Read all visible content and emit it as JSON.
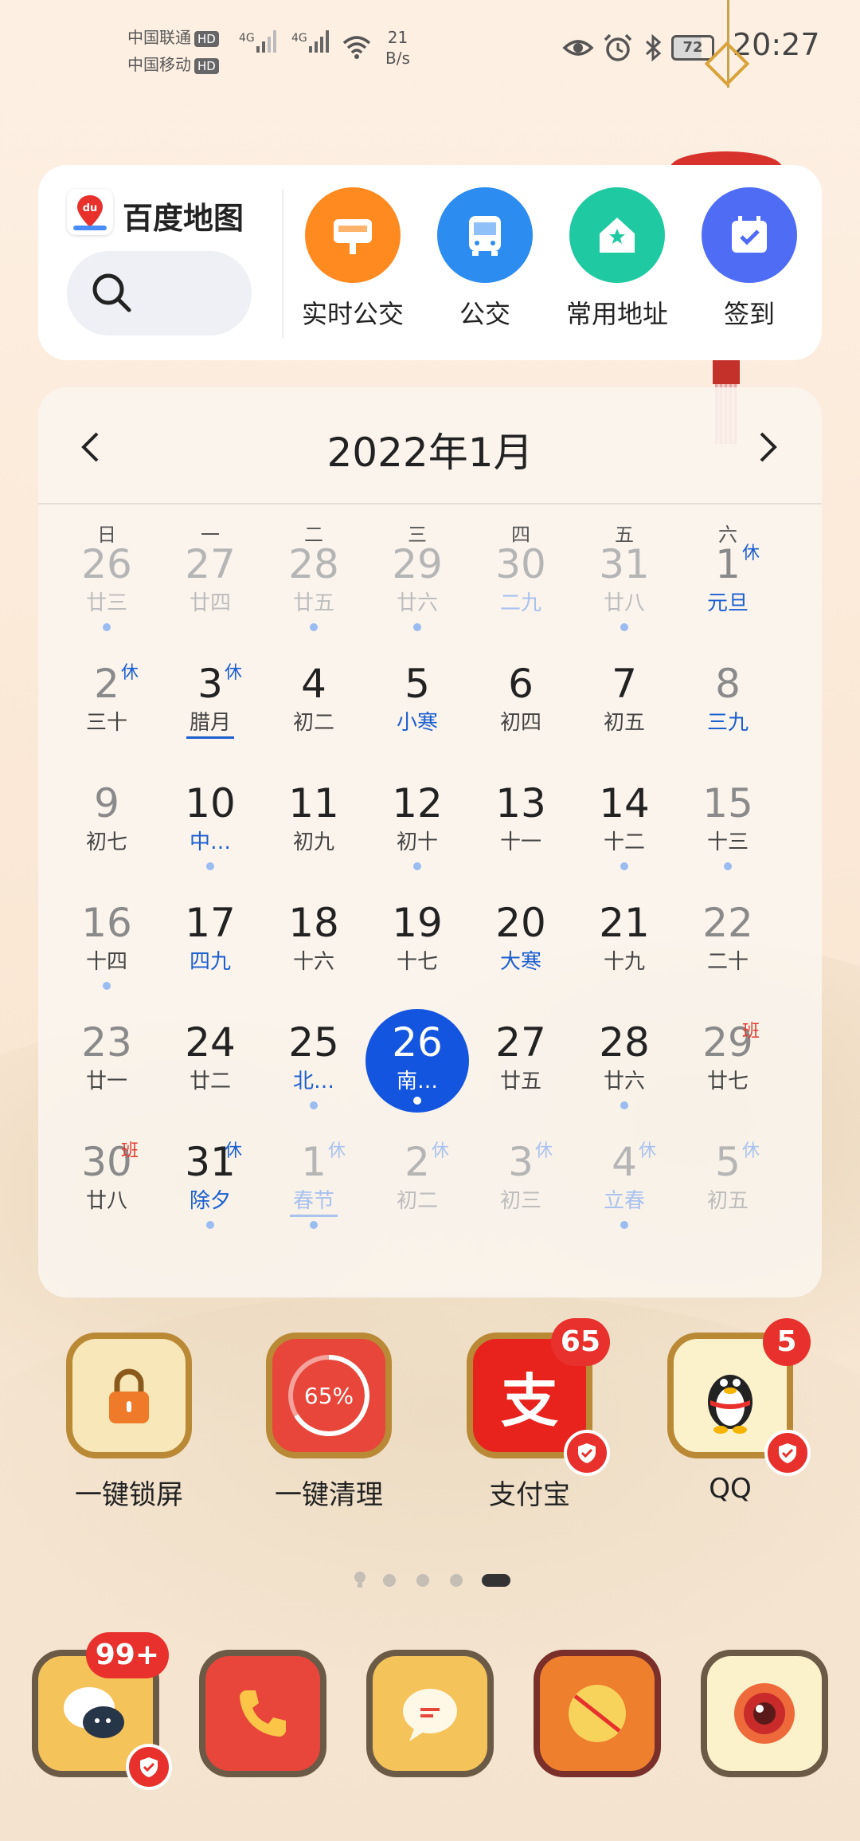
{
  "status_bar": {
    "carrier1": "中国联通",
    "carrier2": "中国移动",
    "hd_label": "HD",
    "network1": "4G",
    "network2": "4G",
    "net_speed_value": "21",
    "net_speed_unit": "B/s",
    "battery": "72",
    "time": "20:27",
    "icons": [
      "eye-comfort-icon",
      "alarm-icon",
      "bluetooth-icon"
    ]
  },
  "baidu_widget": {
    "app_name": "百度地图",
    "logo_text": "du",
    "actions": [
      {
        "label": "实时公交",
        "icon": "bus-stop-icon",
        "color": "#ff8a1f"
      },
      {
        "label": "公交",
        "icon": "bus-icon",
        "color": "#2d8cf0"
      },
      {
        "label": "常用地址",
        "icon": "home-star-icon",
        "color": "#1fc9a2"
      },
      {
        "label": "签到",
        "icon": "calendar-check-icon",
        "color": "#4f6cf5"
      }
    ]
  },
  "calendar": {
    "title": "2022年1月",
    "weekdays": [
      "日",
      "一",
      "二",
      "三",
      "四",
      "五",
      "六"
    ],
    "rest_label": "休",
    "work_label": "班",
    "rows": [
      [
        {
          "n": "26",
          "l": "廿三",
          "other": true,
          "dot": true
        },
        {
          "n": "27",
          "l": "廿四",
          "other": true
        },
        {
          "n": "28",
          "l": "廿五",
          "other": true,
          "dot": true
        },
        {
          "n": "29",
          "l": "廿六",
          "other": true,
          "dot": true
        },
        {
          "n": "30",
          "l": "二九",
          "other": true,
          "blue": true
        },
        {
          "n": "31",
          "l": "廿八",
          "other": true,
          "dot": true
        },
        {
          "n": "1",
          "l": "元旦",
          "blue": true,
          "tag": "休",
          "weekend": true
        }
      ],
      [
        {
          "n": "2",
          "l": "三十",
          "tag": "休",
          "weekend": true
        },
        {
          "n": "3",
          "l": "腊月",
          "tag": "休",
          "underline": true
        },
        {
          "n": "4",
          "l": "初二"
        },
        {
          "n": "5",
          "l": "小寒",
          "blue": true
        },
        {
          "n": "6",
          "l": "初四"
        },
        {
          "n": "7",
          "l": "初五"
        },
        {
          "n": "8",
          "l": "三九",
          "blue": true,
          "weekend": true
        }
      ],
      [
        {
          "n": "9",
          "l": "初七",
          "weekend": true
        },
        {
          "n": "10",
          "l": "中…",
          "blue": true,
          "dot": true
        },
        {
          "n": "11",
          "l": "初九"
        },
        {
          "n": "12",
          "l": "初十",
          "dot": true
        },
        {
          "n": "13",
          "l": "十一"
        },
        {
          "n": "14",
          "l": "十二",
          "dot": true
        },
        {
          "n": "15",
          "l": "十三",
          "weekend": true,
          "dot": true
        }
      ],
      [
        {
          "n": "16",
          "l": "十四",
          "weekend": true,
          "dot": true
        },
        {
          "n": "17",
          "l": "四九",
          "blue": true
        },
        {
          "n": "18",
          "l": "十六"
        },
        {
          "n": "19",
          "l": "十七"
        },
        {
          "n": "20",
          "l": "大寒",
          "blue": true
        },
        {
          "n": "21",
          "l": "十九"
        },
        {
          "n": "22",
          "l": "二十",
          "weekend": true
        }
      ],
      [
        {
          "n": "23",
          "l": "廿一",
          "weekend": true
        },
        {
          "n": "24",
          "l": "廿二"
        },
        {
          "n": "25",
          "l": "北…",
          "blue": true,
          "dot": true
        },
        {
          "n": "26",
          "l": "南…",
          "today": true,
          "dot": true
        },
        {
          "n": "27",
          "l": "廿五"
        },
        {
          "n": "28",
          "l": "廿六",
          "dot": true
        },
        {
          "n": "29",
          "l": "廿七",
          "weekend": true,
          "tag": "班",
          "work": true
        }
      ],
      [
        {
          "n": "30",
          "l": "廿八",
          "weekend": true,
          "tag": "班",
          "work": true
        },
        {
          "n": "31",
          "l": "除夕",
          "blue": true,
          "tag": "休",
          "dot": true
        },
        {
          "n": "1",
          "l": "春节",
          "other": true,
          "blue": true,
          "tag": "休",
          "underline": true,
          "dot": true
        },
        {
          "n": "2",
          "l": "初二",
          "other": true,
          "tag": "休"
        },
        {
          "n": "3",
          "l": "初三",
          "other": true,
          "tag": "休"
        },
        {
          "n": "4",
          "l": "立春",
          "other": true,
          "blue": true,
          "tag": "休",
          "dot": true
        },
        {
          "n": "5",
          "l": "初五",
          "other": true,
          "tag": "休"
        }
      ]
    ]
  },
  "apps": [
    {
      "label": "一键锁屏",
      "icon": "lock-icon"
    },
    {
      "label": "一键清理",
      "icon": "cleanup-icon",
      "progress_text": "65%"
    },
    {
      "label": "支付宝",
      "icon": "alipay-icon",
      "badge": "65",
      "glyph": "支"
    },
    {
      "label": "QQ",
      "icon": "qq-penguin-icon",
      "badge": "5"
    }
  ],
  "page_indicator": {
    "count": 5,
    "active_index": 4
  },
  "dock": [
    {
      "icon": "chat-icon",
      "badge": "99+"
    },
    {
      "icon": "phone-icon"
    },
    {
      "icon": "messages-icon"
    },
    {
      "icon": "no-disturb-icon"
    },
    {
      "icon": "camera-icon"
    }
  ]
}
